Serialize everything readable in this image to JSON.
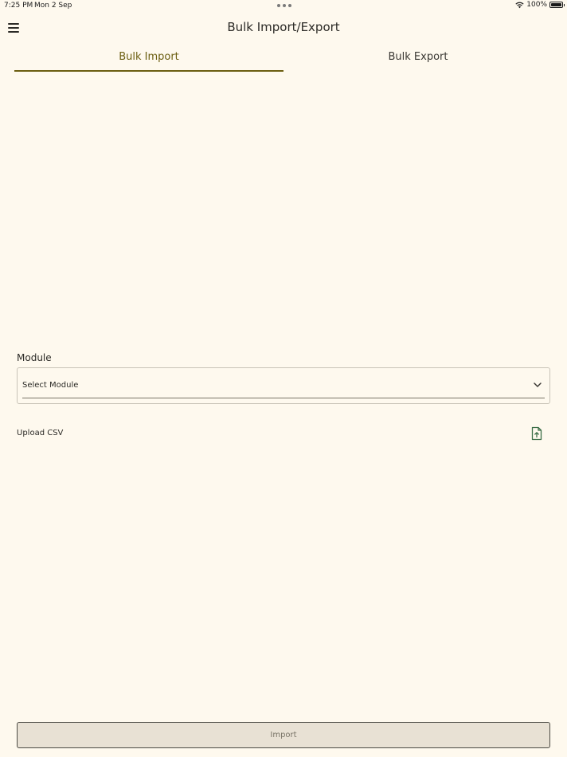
{
  "status_bar": {
    "time": "7:25 PM",
    "date": "Mon 2 Sep",
    "battery": "100%",
    "icons": [
      "wifi-icon",
      "battery-icon"
    ]
  },
  "header": {
    "title": "Bulk Import/Export",
    "menu_icon": "hamburger-menu-icon"
  },
  "tabs": [
    {
      "label": "Bulk Import",
      "active": true
    },
    {
      "label": "Bulk Export",
      "active": false
    }
  ],
  "form": {
    "module_label": "Module",
    "module_select_value": "Select Module",
    "upload_label": "Upload CSV",
    "upload_icon": "file-upload-icon"
  },
  "import_button": {
    "label": "Import",
    "enabled": false
  },
  "colors": {
    "background": "#FEF9EE",
    "accent": "#6B5E10",
    "icon_green": "#3C6E47",
    "button_bg": "#E8E1D4"
  }
}
